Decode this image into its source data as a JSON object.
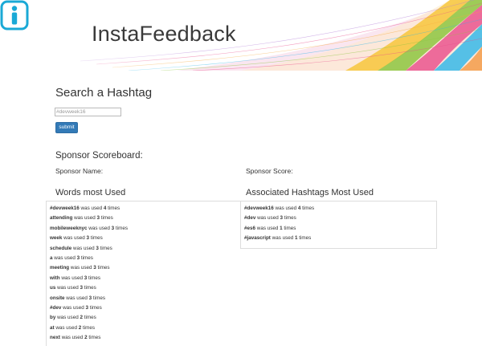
{
  "header": {
    "app_title": "InstaFeedback",
    "logo_icon": "info-i-icon",
    "accent_color": "#1aa9d6"
  },
  "search": {
    "heading": "Search a Hashtag",
    "placeholder": "#devweek16",
    "submit_label": "submit",
    "button_color": "#337ab7"
  },
  "scoreboard": {
    "heading": "Sponsor Scoreboard:",
    "name_label": "Sponsor Name:",
    "score_label": "Sponsor Score:"
  },
  "words": {
    "heading": "Words most Used",
    "items": [
      {
        "word": "#devweek16",
        "mid": " was used ",
        "count": "4",
        "suffix": " times"
      },
      {
        "word": "attending",
        "mid": " was used ",
        "count": "3",
        "suffix": " times"
      },
      {
        "word": "mobileweeknyc",
        "mid": " was used ",
        "count": "3",
        "suffix": " times"
      },
      {
        "word": "week",
        "mid": " was used ",
        "count": "3",
        "suffix": " times"
      },
      {
        "word": "schedule",
        "mid": " was used ",
        "count": "3",
        "suffix": " times"
      },
      {
        "word": "a",
        "mid": " was used ",
        "count": "3",
        "suffix": " times"
      },
      {
        "word": "meeting",
        "mid": " was used ",
        "count": "3",
        "suffix": " times"
      },
      {
        "word": "with",
        "mid": " was used ",
        "count": "3",
        "suffix": " times"
      },
      {
        "word": "us",
        "mid": " was used ",
        "count": "3",
        "suffix": " times"
      },
      {
        "word": "onsite",
        "mid": " was used ",
        "count": "3",
        "suffix": " times"
      },
      {
        "word": "#dev",
        "mid": " was used ",
        "count": "3",
        "suffix": " times"
      },
      {
        "word": "by",
        "mid": " was used ",
        "count": "2",
        "suffix": " times"
      },
      {
        "word": "at",
        "mid": " was used ",
        "count": "2",
        "suffix": " times"
      },
      {
        "word": "next",
        "mid": " was used ",
        "count": "2",
        "suffix": " times"
      }
    ]
  },
  "hashtags": {
    "heading": "Associated Hashtags Most Used",
    "items": [
      {
        "word": "#devweek16",
        "mid": " was used ",
        "count": "4",
        "suffix": " times"
      },
      {
        "word": "#dev",
        "mid": " was used ",
        "count": "3",
        "suffix": " times"
      },
      {
        "word": "#es6",
        "mid": " was used ",
        "count": "1",
        "suffix": " times"
      },
      {
        "word": "#javascript",
        "mid": " was used ",
        "count": "1",
        "suffix": " times"
      }
    ]
  }
}
